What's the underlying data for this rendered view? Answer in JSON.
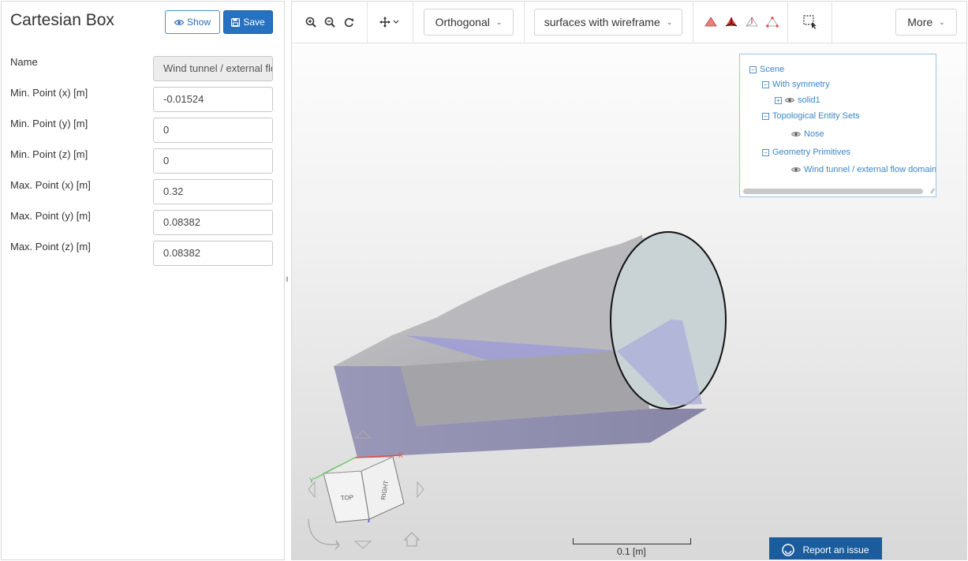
{
  "panel": {
    "title": "Cartesian Box",
    "show_label": "Show",
    "save_label": "Save",
    "fields": [
      {
        "label": "Name",
        "value": "Wind tunnel / external flow domain",
        "readonly": true
      },
      {
        "label": "Min. Point (x) [m]",
        "value": "-0.01524"
      },
      {
        "label": "Min. Point (y) [m]",
        "value": "0"
      },
      {
        "label": "Min. Point (z) [m]",
        "value": "0"
      },
      {
        "label": "Max. Point (x) [m]",
        "value": "0.32"
      },
      {
        "label": "Max. Point (y) [m]",
        "value": "0.08382"
      },
      {
        "label": "Max. Point (z) [m]",
        "value": "0.08382"
      }
    ]
  },
  "toolbar": {
    "projection": "Orthogonal",
    "render_mode": "surfaces with wireframe",
    "more_label": "More"
  },
  "scene_tree": {
    "root": "Scene",
    "groups": [
      {
        "label": "With symmetry",
        "items": [
          "solid1"
        ]
      },
      {
        "label": "Topological Entity Sets",
        "items": [
          "Nose"
        ]
      },
      {
        "label": "Geometry Primitives",
        "items": [
          "Wind tunnel / external flow domain"
        ]
      }
    ]
  },
  "orientation_cube": {
    "top": "TOP",
    "right": "RIGHT",
    "x_axis": "X",
    "y_axis": "Y"
  },
  "scale": {
    "label": "0.1 [m]"
  },
  "report_issue": "Report an issue",
  "colors": {
    "primary": "#2672c0",
    "link": "#3a86c8",
    "report_bg": "#1b5d9c"
  }
}
